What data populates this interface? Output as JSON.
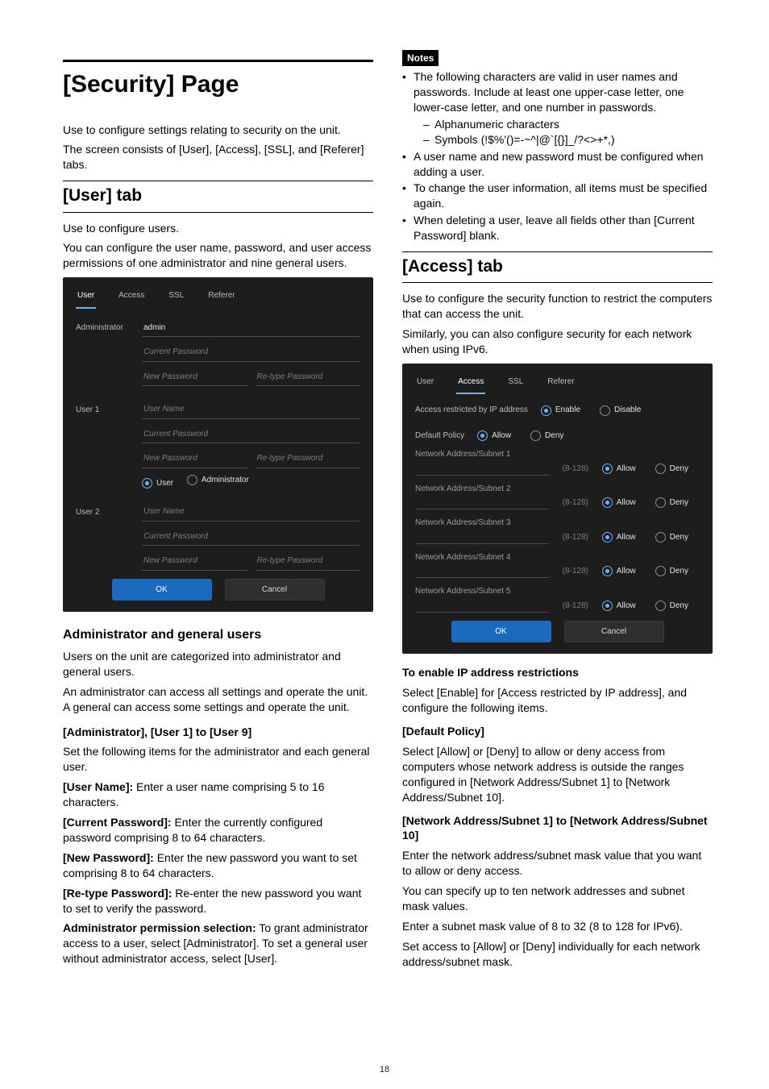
{
  "page_number": "18",
  "left": {
    "page_title": "[Security] Page",
    "intro1": "Use to configure settings relating to security on the unit.",
    "intro2": "The screen consists of [User], [Access], [SSL], and [Referer] tabs.",
    "user_tab_title": "[User] tab",
    "user_tab_p1": "Use to configure users.",
    "user_tab_p2": "You can configure the user name, password, and user access permissions of one administrator and nine general users.",
    "shot1": {
      "tabs": [
        "User",
        "Access",
        "SSL",
        "Referer"
      ],
      "admin_label": "Administrator",
      "admin_value": "admin",
      "current_password": "Current Password",
      "new_password": "New Password",
      "retype_password": "Re-type Password",
      "user1_label": "User 1",
      "user_name": "User Name",
      "role_user": "User",
      "role_admin": "Administrator",
      "user2_label": "User 2",
      "ok": "OK",
      "cancel": "Cancel"
    },
    "sub_admin_title": "Administrator and general users",
    "sub_admin_p1": "Users on the unit are categorized into administrator and general users.",
    "sub_admin_p2": "An administrator can access all settings and operate the unit. A general can access some settings and operate the unit.",
    "admin_user_heading": "[Administrator], [User 1] to [User 9]",
    "admin_user_intro": "Set the following items for the administrator and each general user.",
    "items": {
      "user_name_label": "[User Name]:",
      "user_name_text": " Enter a user name comprising 5 to 16 characters.",
      "current_pw_label": "[Current Password]:",
      "current_pw_text": " Enter the currently configured password comprising 8 to 64 characters.",
      "new_pw_label": "[New Password]:",
      "new_pw_text": " Enter the new password you want to set comprising 8 to 64 characters.",
      "retype_pw_label": "[Re-type Password]:",
      "retype_pw_text": " Re-enter the new password you want to set to verify the password.",
      "perm_label": "Administrator permission selection:",
      "perm_text": " To grant administrator access to a user, select [Administrator]. To set a general user without administrator access, select [User]."
    }
  },
  "right": {
    "notes_label": "Notes",
    "note1": "The following characters are valid in user names and passwords. Include at least one upper-case letter, one lower-case letter, and one number in passwords.",
    "note1a": "Alphanumeric characters",
    "note1b": "Symbols (!$%'()=-~^|@`[{}]_/?<>+*,)",
    "note2": "A user name and new password must be configured when adding a user.",
    "note3": "To change the user information, all items must be specified again.",
    "note4": "When deleting a user, leave all fields other than [Current Password] blank.",
    "access_tab_title": "[Access] tab",
    "access_p1": "Use to configure the security function to restrict the computers that can access the unit.",
    "access_p2": "Similarly, you can also configure security for each network when using IPv6.",
    "shot2": {
      "tabs": [
        "User",
        "Access",
        "SSL",
        "Referer"
      ],
      "restricted_label": "Access restricted by IP address",
      "enable": "Enable",
      "disable": "Disable",
      "default_policy": "Default Policy",
      "allow": "Allow",
      "deny": "Deny",
      "rows": [
        "Network Address/Subnet 1",
        "Network Address/Subnet 2",
        "Network Address/Subnet 3",
        "Network Address/Subnet 4",
        "Network Address/Subnet 5"
      ],
      "hint": "(8-128)",
      "ok": "OK",
      "cancel": "Cancel"
    },
    "enable_ip_heading": "To enable IP address restrictions",
    "enable_ip_text": "Select [Enable] for [Access restricted by IP address], and configure the following items.",
    "default_policy_heading": "[Default Policy]",
    "default_policy_text": "Select [Allow] or [Deny] to allow or deny access from computers whose network address is outside the ranges configured in [Network Address/Subnet 1] to [Network Address/Subnet 10].",
    "net_heading": "[Network Address/Subnet 1] to [Network Address/Subnet 10]",
    "net_p1": "Enter the network address/subnet mask value that you want to allow or deny access.",
    "net_p2": "You can specify up to ten network addresses and subnet mask values.",
    "net_p3": "Enter a subnet mask value of 8 to 32 (8 to 128 for IPv6).",
    "net_p4": "Set access to [Allow] or [Deny] individually for each network address/subnet mask."
  }
}
